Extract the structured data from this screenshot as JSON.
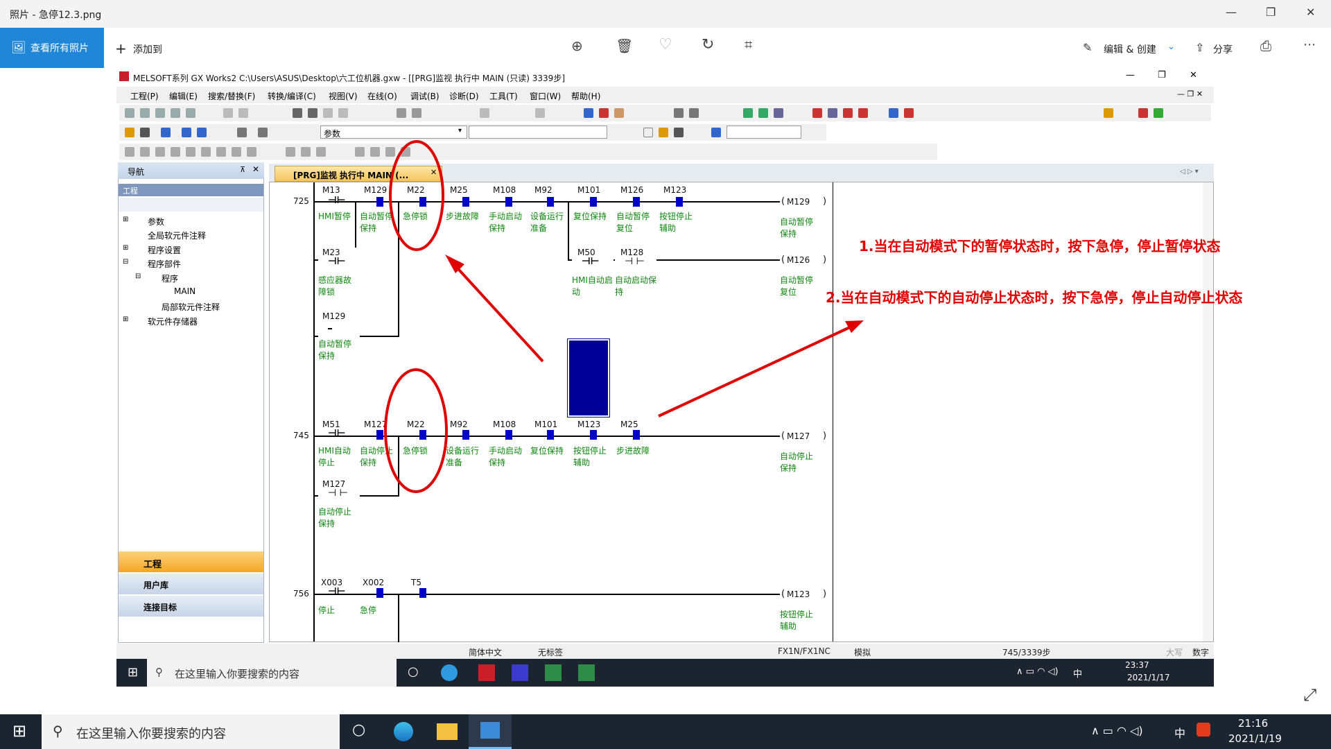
{
  "photos_app": {
    "title": "照片 - 急停12.3.png",
    "view_all": "查看所有照片",
    "add_to": "添加到",
    "edit_create": "编辑 & 创建",
    "share": "分享"
  },
  "gx": {
    "title": "MELSOFT系列 GX Works2 C:\\Users\\ASUS\\Desktop\\六工位机器.gxw - [[PRG]监视 执行中 MAIN (只读) 3339步]",
    "menu": [
      "工程(P)",
      "编辑(E)",
      "搜索/替换(F)",
      "转换/编译(C)",
      "视图(V)",
      "在线(O)",
      "调试(B)",
      "诊断(D)",
      "工具(T)",
      "窗口(W)",
      "帮助(H)"
    ],
    "param_dropdown": "参数",
    "nav_title": "导航",
    "nav_section": "工程",
    "tree": [
      "参数",
      "全局软元件注释",
      "程序设置",
      "程序部件",
      "程序",
      "MAIN",
      "局部软元件注释",
      "软元件存储器"
    ],
    "nav_buttons": [
      "工程",
      "用户库",
      "连接目标"
    ],
    "tab": "[PRG]监视 执行中 MAIN (...",
    "status": {
      "lang": "简体中文",
      "label": "无标签",
      "cpu": "FX1N/FX1NC",
      "mode": "模拟",
      "step": "745/3339步",
      "caps": "大写",
      "num": "数字"
    }
  },
  "ladder": {
    "rung1": {
      "no": "725",
      "contacts": [
        {
          "d": "M13",
          "c": "HMI暂停"
        },
        {
          "d": "M129",
          "c": "自动暂停保持"
        },
        {
          "d": "M22",
          "c": "急停锁"
        },
        {
          "d": "M25",
          "c": "步进故障"
        },
        {
          "d": "M108",
          "c": "手动启动保持"
        },
        {
          "d": "M92",
          "c": "设备运行准备"
        },
        {
          "d": "M101",
          "c": "复位保持"
        },
        {
          "d": "M126",
          "c": "自动暂停复位"
        },
        {
          "d": "M123",
          "c": "按钮停止辅助"
        }
      ],
      "coil": "M129",
      "coil_c": "自动暂停保持"
    },
    "rung1b": {
      "contacts": [
        {
          "d": "M23",
          "c": "感应器故障锁"
        },
        {
          "d": "M129",
          "c": "自动暂停保持"
        },
        {
          "d": "M50",
          "c": "HMI自动启动"
        },
        {
          "d": "M128",
          "c": "自动启动保持"
        }
      ],
      "coil": "M126",
      "coil_c": "自动暂停复位"
    },
    "rung2": {
      "no": "745",
      "contacts": [
        {
          "d": "M51",
          "c": "HMI自动停止"
        },
        {
          "d": "M127",
          "c": "自动停止保持"
        },
        {
          "d": "M22",
          "c": "急停锁"
        },
        {
          "d": "M92",
          "c": "设备运行准备"
        },
        {
          "d": "M108",
          "c": "手动启动保持"
        },
        {
          "d": "M101",
          "c": "复位保持"
        },
        {
          "d": "M123",
          "c": "按钮停止辅助"
        },
        {
          "d": "M25",
          "c": "步进故障"
        }
      ],
      "coil": "M127",
      "coil_c": "自动停止保持",
      "para": {
        "d": "M127",
        "c": "自动停止保持"
      }
    },
    "rung3": {
      "no": "756",
      "contacts": [
        {
          "d": "X003",
          "c": "停止"
        },
        {
          "d": "X002",
          "c": "急停"
        },
        {
          "d": "T5",
          "c": ""
        }
      ],
      "coil": "M123",
      "coil_c": "按钮停止辅助"
    }
  },
  "notes": [
    "1.当在自动模式下的暂停状态时，按下急停，停止暂停状态",
    "2.当在自动模式下的自动停止状态时，按下急停，停止自动停止状态"
  ],
  "inner_taskbar": {
    "search": "在这里输入你要搜索的内容",
    "time": "23:37",
    "date": "2021/1/17",
    "ime": "中"
  },
  "outer_taskbar": {
    "search": "在这里输入你要搜索的内容",
    "time": "21:16",
    "date": "2021/1/19",
    "ime": "中"
  },
  "colors": {
    "accent": "#1f86d8",
    "annotation": "#e00000",
    "comment": "#118811",
    "monitor_on": "#0000cc"
  }
}
